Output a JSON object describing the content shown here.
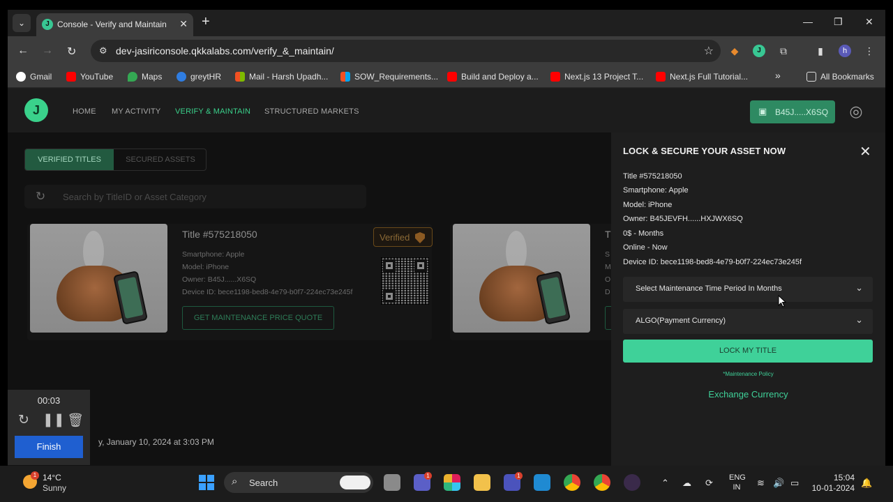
{
  "browser": {
    "tab_title": "Console - Verify and Maintain",
    "url": "dev-jasiriconsole.qkkalabs.com/verify_&_maintain/",
    "bookmarks": [
      {
        "label": "Gmail",
        "color": "#ea4335"
      },
      {
        "label": "YouTube",
        "color": "#ff0000"
      },
      {
        "label": "Maps",
        "color": "#34a853"
      },
      {
        "label": "greytHR",
        "color": "#2f7de1"
      },
      {
        "label": "Mail - Harsh Upadh...",
        "color": "#f25022"
      },
      {
        "label": "SOW_Requirements...",
        "color": "#f25022"
      },
      {
        "label": "Build and Deploy a...",
        "color": "#ff0000"
      },
      {
        "label": "Next.js 13 Project T...",
        "color": "#ff0000"
      },
      {
        "label": "Next.js Full Tutorial...",
        "color": "#ff0000"
      }
    ],
    "all_bookmarks": "All Bookmarks",
    "profile_initial": "h"
  },
  "site": {
    "logo_letter": "J",
    "nav": [
      "HOME",
      "MY ACTIVITY",
      "VERIFY & MAINTAIN",
      "STRUCTURED MARKETS"
    ],
    "wallet_label": "B45J.....X6SQ"
  },
  "main": {
    "tabs": [
      "VERIFIED TITLES",
      "SECURED ASSETS"
    ],
    "search_placeholder": "Search by TitleID or Asset Category",
    "card": {
      "title": "Title #575218050",
      "category": "Smartphone: Apple",
      "model": "Model: iPhone",
      "owner": "Owner: B45J......X6SQ",
      "device": "Device ID: bece1198-bed8-4e79-b0f7-224ec73e245f",
      "quote_button": "GET MAINTENANCE PRICE QUOTE",
      "badge": "Verified"
    },
    "card2": {
      "title_partial": "T",
      "line1": "S",
      "line2": "M",
      "line3": "O",
      "line4": "D"
    },
    "footer_date": "y, January 10, 2024 at 3:03 PM"
  },
  "recorder": {
    "time": "00:03",
    "finish": "Finish"
  },
  "panel": {
    "title": "LOCK & SECURE YOUR ASSET NOW",
    "lines": [
      "Title #575218050",
      "Smartphone: Apple",
      "Model: iPhone",
      "Owner: B45JEVFH......HXJWX6SQ",
      "0$ - Months",
      "Online - Now",
      "Device ID: bece1198-bed8-4e79-b0f7-224ec73e245f"
    ],
    "select_period": "Select Maintenance Time Period In Months",
    "select_currency": "ALGO(Payment Currency)",
    "lock_button": "LOCK MY TITLE",
    "policy": "*Maintenance Policy",
    "exchange": "Exchange Currency"
  },
  "taskbar": {
    "temp": "14°C",
    "condition": "Sunny",
    "weather_badge": "1",
    "search_label": "Search",
    "lang_top": "ENG",
    "lang_bottom": "IN",
    "time": "15:04",
    "date": "10-01-2024",
    "teams_badge": "1",
    "chat_badge": "1"
  },
  "colors": {
    "accent": "#3fd199",
    "wallet": "#2e8a62"
  }
}
